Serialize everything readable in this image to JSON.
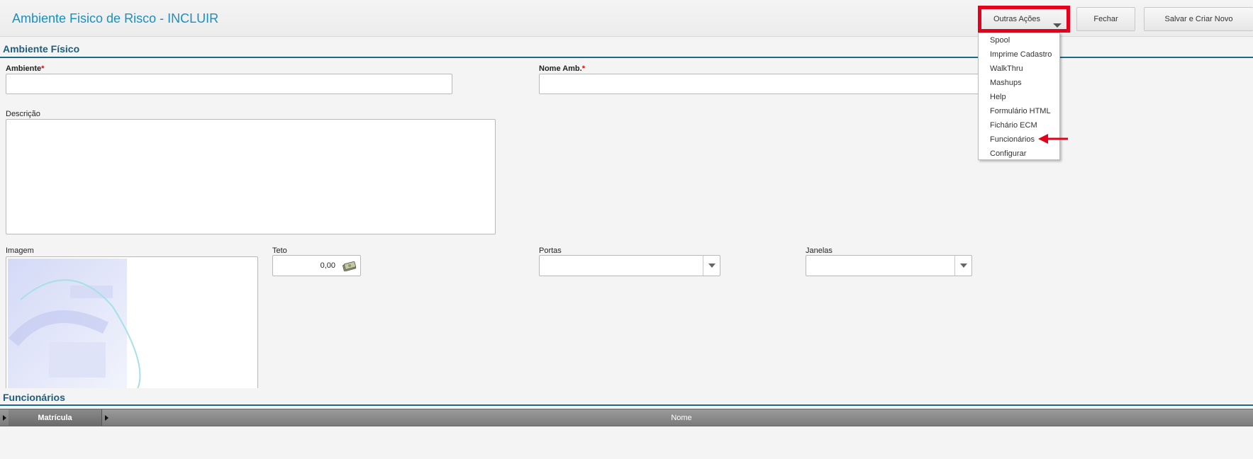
{
  "header": {
    "title": "Ambiente Fisico de Risco - INCLUIR",
    "buttons": {
      "outras_acoes": "Outras Ações",
      "fechar": "Fechar",
      "salvar_criar_novo": "Salvar e Criar Novo"
    }
  },
  "dropdown_menu": {
    "items": [
      "Spool",
      "Imprime Cadastro",
      "WalkThru",
      "Mashups",
      "Help",
      "Formulário HTML",
      "Fichário ECM",
      "Funcionários",
      "Configurar"
    ]
  },
  "form": {
    "section_title": "Ambiente Físico",
    "ambiente": {
      "label": "Ambiente",
      "required_mark": "*",
      "value": ""
    },
    "nome_amb": {
      "label": "Nome Amb.",
      "required_mark": "*",
      "value": ""
    },
    "descricao": {
      "label": "Descrição",
      "value": ""
    },
    "imagem": {
      "label": "Imagem"
    },
    "teto": {
      "label": "Teto",
      "value": "0,00"
    },
    "portas": {
      "label": "Portas",
      "value": ""
    },
    "janelas": {
      "label": "Janelas",
      "value": ""
    }
  },
  "funcionarios": {
    "section_title": "Funcionários",
    "columns": [
      "Matrícula",
      "Nome"
    ],
    "rows": []
  },
  "colors": {
    "title_blue": "#1a8fc2",
    "section_blue": "#1b5e7e",
    "highlight_red": "#e5001b",
    "required_red": "#ee0000"
  }
}
